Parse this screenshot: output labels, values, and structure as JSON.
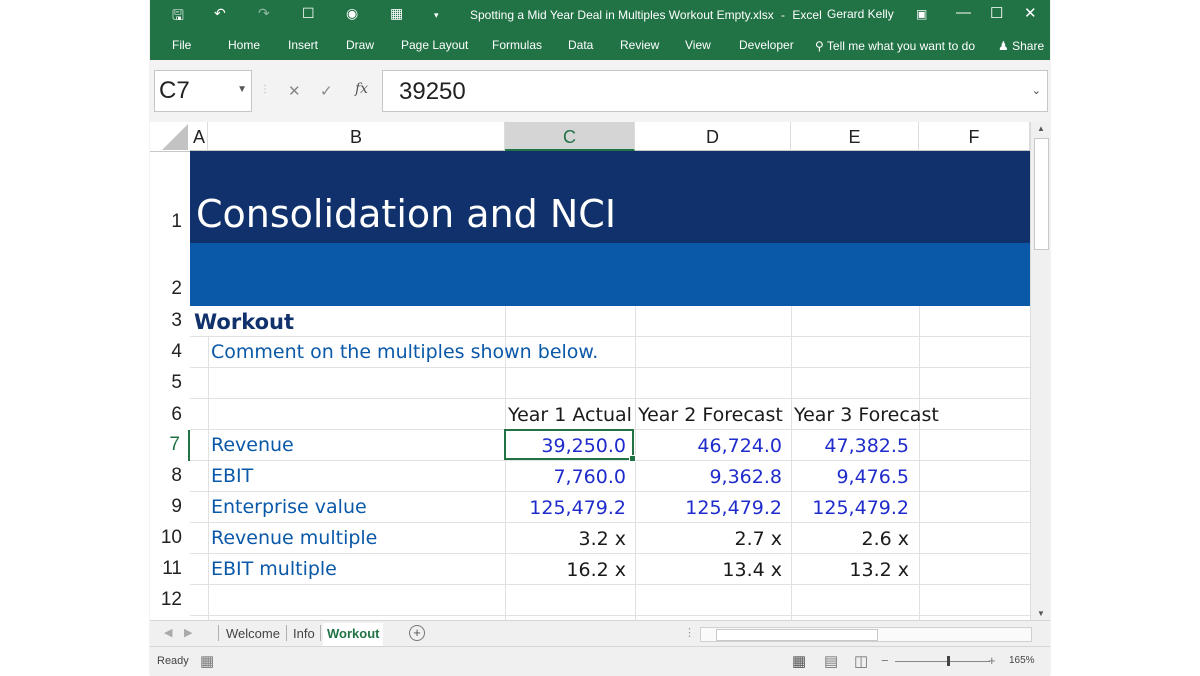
{
  "titlebar": {
    "document_title": "Spotting a Mid Year Deal in Multiples Workout Empty.xlsx",
    "separator": "-",
    "app_name": "Excel",
    "user_name": "Gerard Kelly"
  },
  "ribbon": {
    "tabs": [
      "File",
      "Home",
      "Insert",
      "Draw",
      "Page Layout",
      "Formulas",
      "Data",
      "Review",
      "View",
      "Developer"
    ],
    "tell_me": "Tell me what you want to do",
    "share": "Share"
  },
  "formula_bar": {
    "name_box": "C7",
    "fx_label": "fx",
    "value": "39250"
  },
  "columns": [
    "A",
    "B",
    "C",
    "D",
    "E",
    "F"
  ],
  "selected_column": "C",
  "rows": [
    "1",
    "2",
    "3",
    "4",
    "5",
    "6",
    "7",
    "8",
    "9",
    "10",
    "11",
    "12"
  ],
  "selected_row": "7",
  "sheet": {
    "title": "Consolidation and NCI",
    "heading": "Workout",
    "comment": "Comment on the multiples shown below.",
    "col_headers": [
      "Year 1 Actual",
      "Year 2 Forecast",
      "Year 3 Forecast"
    ],
    "table": [
      {
        "label": "Revenue",
        "values": [
          "39,250.0",
          "46,724.0",
          "47,382.5"
        ],
        "style": "input"
      },
      {
        "label": "EBIT",
        "values": [
          "7,760.0",
          "9,362.8",
          "9,476.5"
        ],
        "style": "input"
      },
      {
        "label": "Enterprise value",
        "values": [
          "125,479.2",
          "125,479.2",
          "125,479.2"
        ],
        "style": "input"
      },
      {
        "label": "Revenue multiple",
        "values": [
          "3.2 x",
          "2.7 x",
          "2.6 x"
        ],
        "style": "calc"
      },
      {
        "label": "EBIT multiple",
        "values": [
          "16.2 x",
          "13.4 x",
          "13.2 x"
        ],
        "style": "calc"
      }
    ]
  },
  "sheet_tabs": [
    "Welcome",
    "Info",
    "Workout"
  ],
  "active_sheet": "Workout",
  "status": {
    "mode": "Ready",
    "zoom": "165%"
  },
  "colors": {
    "excel_green": "#217346",
    "title_band": "#10316b",
    "subtitle_band": "#0a58a8",
    "input_blue": "#1f2ccb"
  }
}
